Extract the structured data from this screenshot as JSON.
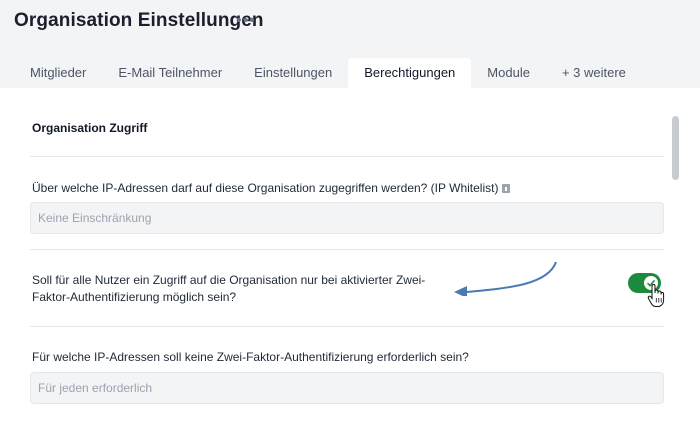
{
  "header": {
    "title": "Organisation Einstellungen",
    "more_label": "•••"
  },
  "tabs": [
    {
      "label": "Mitglieder",
      "active": false
    },
    {
      "label": "E-Mail Teilnehmer",
      "active": false
    },
    {
      "label": "Einstellungen",
      "active": false
    },
    {
      "label": "Berechtigungen",
      "active": true
    },
    {
      "label": "Module",
      "active": false
    },
    {
      "label": "+ 3 weitere",
      "active": false
    }
  ],
  "section": {
    "title": "Organisation Zugriff"
  },
  "ip_whitelist": {
    "label": "Über welche IP-Adressen darf auf diese Organisation zugegriffen werden? (IP Whitelist)",
    "placeholder": "Keine Einschränkung",
    "info_icon": "info-icon"
  },
  "two_factor": {
    "label_line1": "Soll für alle Nutzer ein Zugriff auf die Organisation nur bei aktivierter Zwei-",
    "label_line2": "Faktor-Authentifizierung möglich sein?",
    "enabled": true,
    "toggle_color": "#1e8a3e"
  },
  "two_factor_exceptions": {
    "label": "Für welche IP-Adressen soll keine Zwei-Faktor-Authentifizierung erforderlich sein?",
    "placeholder": "Für jeden erforderlich"
  },
  "annotation": {
    "arrow_color": "#4a7ab5"
  }
}
